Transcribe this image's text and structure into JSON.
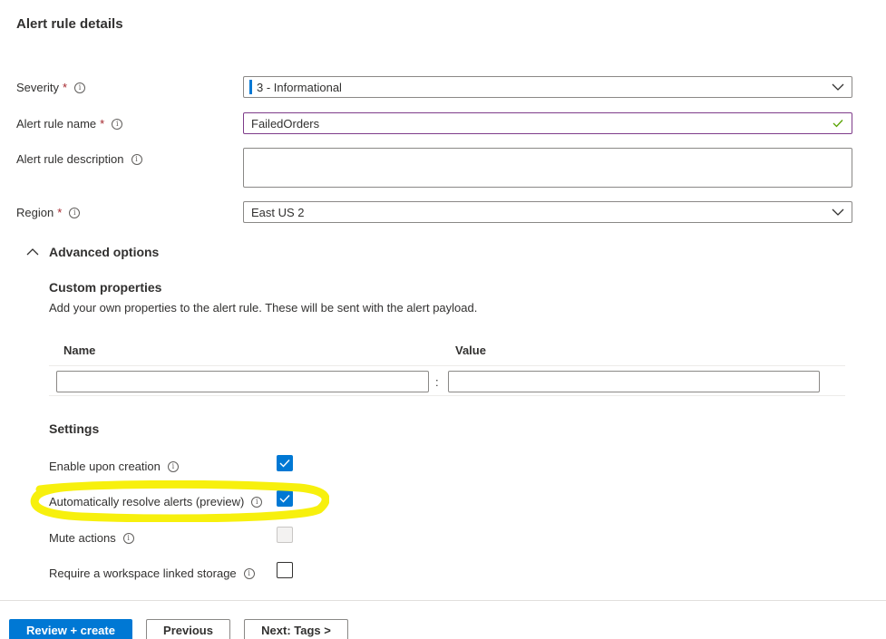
{
  "section": {
    "title": "Alert rule details"
  },
  "fields": {
    "severity": {
      "label": "Severity",
      "required_mark": "*",
      "value": "3 - Informational",
      "icon": "info-icon"
    },
    "name": {
      "label": "Alert rule name",
      "required_mark": "*",
      "value": "FailedOrders",
      "icon": "info-icon",
      "validation_icon": "checkmark-icon"
    },
    "description": {
      "label": "Alert rule description",
      "value": "",
      "icon": "info-icon"
    },
    "region": {
      "label": "Region",
      "required_mark": "*",
      "value": "East US 2",
      "icon": "info-icon"
    }
  },
  "advanced": {
    "toggle_label": "Advanced options",
    "expanded": true,
    "custom_properties": {
      "title": "Custom properties",
      "description": "Add your own properties to the alert rule. These will be sent with the alert payload.",
      "columns": [
        "Name",
        "Value"
      ],
      "separator": ":",
      "rows": [
        {
          "name": "",
          "value": ""
        }
      ]
    },
    "settings": {
      "title": "Settings",
      "items": [
        {
          "label": "Enable upon creation",
          "checked": true,
          "disabled": false
        },
        {
          "label": "Automatically resolve alerts (preview)",
          "checked": true,
          "disabled": false,
          "highlighted": true
        },
        {
          "label": "Mute actions",
          "checked": false,
          "disabled": true
        },
        {
          "label": "Require a workspace linked storage",
          "checked": false,
          "disabled": false
        }
      ]
    }
  },
  "footer": {
    "review_create": "Review + create",
    "previous": "Previous",
    "next": "Next: Tags >"
  },
  "colors": {
    "primary": "#0078d4",
    "required": "#a4262c",
    "valid_check": "#57a300",
    "highlight": "#f7ef00"
  }
}
